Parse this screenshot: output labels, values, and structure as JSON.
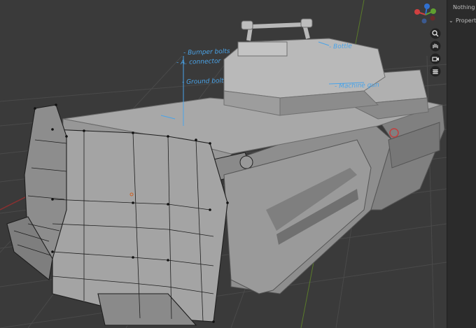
{
  "side_panel": {
    "nothing_selected": "Nothing sele",
    "properties": "Propertie"
  },
  "navigation": {
    "gizmo": "axis-gizmo-icon",
    "zoom": "zoom-icon",
    "pan": "hand-icon",
    "camera": "camera-icon",
    "grid_view": "grid-icon"
  },
  "annotations": [
    "- Bumper bolts",
    "- A. connector",
    "- Ground bolt",
    "- Bottle",
    "- Machine gun"
  ],
  "colors": {
    "viewport_bg": "#3a3a3a",
    "panel_bg": "#2b2b2b",
    "mesh": "#9b9b9b",
    "annotation": "#4aa3e8"
  }
}
